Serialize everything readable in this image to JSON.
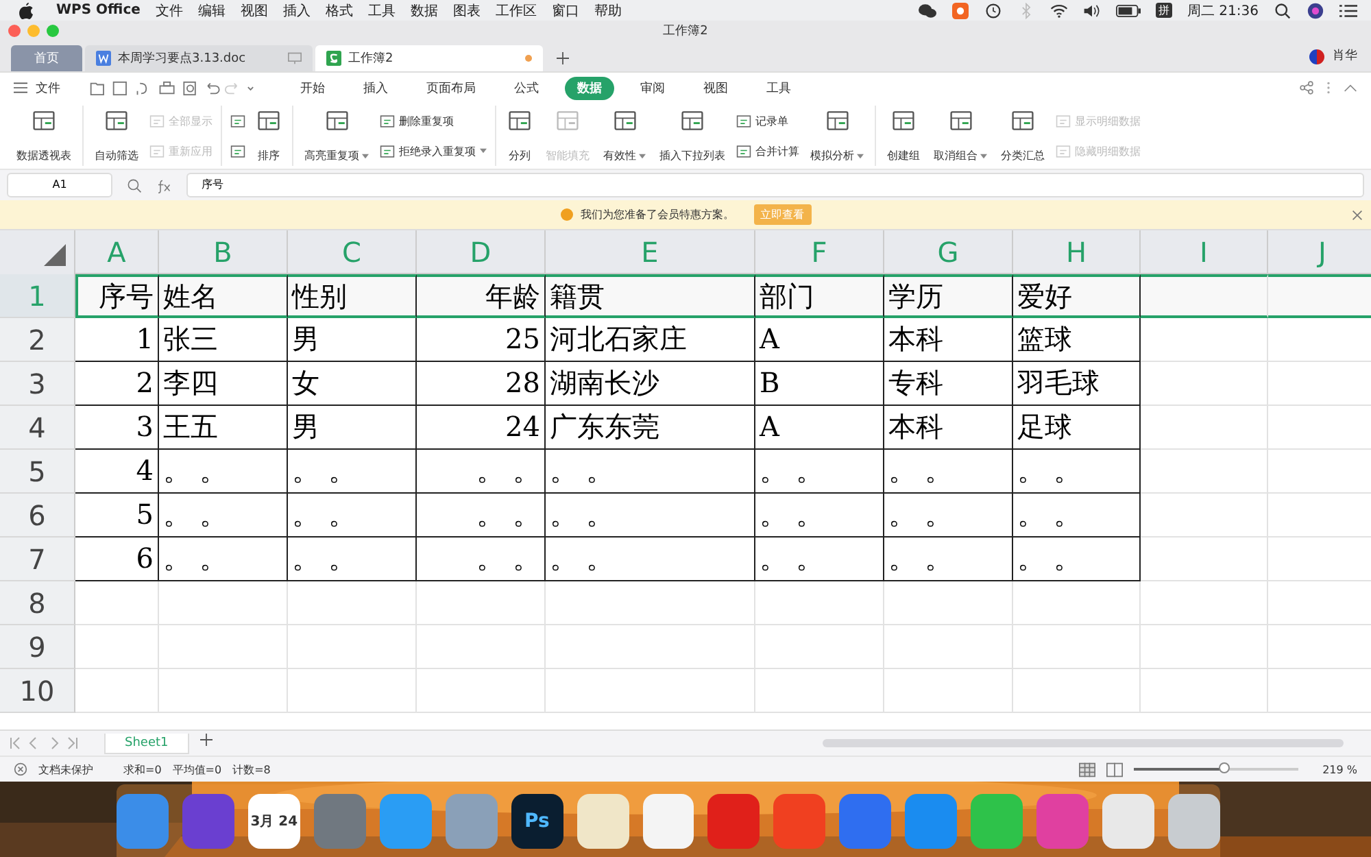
{
  "menubar": {
    "app": "WPS Office",
    "items": [
      "文件",
      "编辑",
      "视图",
      "插入",
      "格式",
      "工具",
      "数据",
      "图表",
      "工作区",
      "窗口",
      "帮助"
    ],
    "ime": "拼",
    "clock": "周二 21:36"
  },
  "window": {
    "title": "工作簿2",
    "user": "肖华"
  },
  "doc_tabs": [
    {
      "label": "首页",
      "kind": "home",
      "selected": false,
      "modified": false
    },
    {
      "label": "本周学习要点3.13.doc",
      "kind": "writer",
      "selected": false,
      "modified": false
    },
    {
      "label": "工作簿2",
      "kind": "sheet",
      "selected": true,
      "modified": true
    }
  ],
  "file_menu": "文件",
  "ribbon_tabs": [
    {
      "label": "开始",
      "selected": false
    },
    {
      "label": "插入",
      "selected": false
    },
    {
      "label": "页面布局",
      "selected": false
    },
    {
      "label": "公式",
      "selected": false
    },
    {
      "label": "数据",
      "selected": true
    },
    {
      "label": "审阅",
      "selected": false
    },
    {
      "label": "视图",
      "selected": false
    },
    {
      "label": "工具",
      "selected": false
    }
  ],
  "ribbon_groups": [
    [
      {
        "kind": "large",
        "label": "数据透视表",
        "disabled": false,
        "dropdown": false
      }
    ],
    [
      {
        "kind": "large",
        "label": "自动筛选",
        "disabled": false,
        "dropdown": false
      },
      {
        "kind": "stack",
        "items": [
          {
            "label": "全部显示",
            "disabled": true,
            "dropdown": false
          },
          {
            "label": "重新应用",
            "disabled": true,
            "dropdown": false
          }
        ]
      }
    ],
    [
      {
        "kind": "stack",
        "items": [
          {
            "disabled": false,
            "dropdown": false
          },
          {
            "disabled": false,
            "dropdown": false
          }
        ]
      },
      {
        "kind": "large",
        "label": "排序",
        "disabled": false,
        "dropdown": false
      }
    ],
    [
      {
        "kind": "large",
        "label": "高亮重复项",
        "disabled": false,
        "dropdown": true
      },
      {
        "kind": "stack",
        "items": [
          {
            "label": "删除重复项",
            "disabled": false,
            "dropdown": false
          },
          {
            "label": "拒绝录入重复项",
            "disabled": false,
            "dropdown": true
          }
        ]
      }
    ],
    [
      {
        "kind": "large",
        "label": "分列",
        "disabled": false,
        "dropdown": false
      },
      {
        "kind": "large",
        "label": "智能填充",
        "disabled": true,
        "dropdown": false
      },
      {
        "kind": "large",
        "label": "有效性",
        "disabled": false,
        "dropdown": true
      },
      {
        "kind": "large",
        "label": "插入下拉列表",
        "disabled": false,
        "dropdown": false
      },
      {
        "kind": "stack",
        "items": [
          {
            "label": "记录单",
            "disabled": false,
            "dropdown": false
          },
          {
            "label": "合并计算",
            "disabled": false,
            "dropdown": false
          }
        ]
      },
      {
        "kind": "large",
        "label": "模拟分析",
        "disabled": false,
        "dropdown": true
      }
    ],
    [
      {
        "kind": "large",
        "label": "创建组",
        "disabled": false,
        "dropdown": false
      },
      {
        "kind": "large",
        "label": "取消组合",
        "disabled": false,
        "dropdown": true
      },
      {
        "kind": "large",
        "label": "分类汇总",
        "disabled": false,
        "dropdown": false
      },
      {
        "kind": "stack",
        "items": [
          {
            "label": "显示明细数据",
            "disabled": true,
            "dropdown": false
          },
          {
            "label": "隐藏明细数据",
            "disabled": true,
            "dropdown": false
          }
        ]
      }
    ]
  ],
  "name_box": "A1",
  "formula": "序号",
  "notice": {
    "text": "我们为您准备了会员特惠方案。",
    "button": "立即查看"
  },
  "sheet": {
    "columns": [
      {
        "label": "A",
        "kind": "number"
      },
      {
        "label": "B",
        "kind": "text"
      },
      {
        "label": "C",
        "kind": "text"
      },
      {
        "label": "D",
        "kind": "number"
      },
      {
        "label": "E",
        "kind": "text"
      },
      {
        "label": "F",
        "kind": "text"
      },
      {
        "label": "G",
        "kind": "text"
      },
      {
        "label": "H",
        "kind": "text"
      },
      {
        "label": "I",
        "kind": "text"
      },
      {
        "label": "J",
        "kind": "text"
      }
    ],
    "rows": [
      {
        "number": "1",
        "selected": true,
        "cells": [
          "序号",
          "姓名",
          "性别",
          "年龄",
          "籍贯",
          "部门",
          "学历",
          "爱好"
        ]
      },
      {
        "number": "2",
        "selected": false,
        "cells": [
          "1",
          "张三",
          "男",
          "25",
          "河北石家庄",
          "A",
          "本科",
          "篮球"
        ]
      },
      {
        "number": "3",
        "selected": false,
        "cells": [
          "2",
          "李四",
          "女",
          "28",
          "湖南长沙",
          "B",
          "专科",
          "羽毛球"
        ]
      },
      {
        "number": "4",
        "selected": false,
        "cells": [
          "3",
          "王五",
          "男",
          "24",
          "广东东莞",
          "A",
          "本科",
          "足球"
        ]
      },
      {
        "number": "5",
        "selected": false,
        "cells": [
          "4",
          "。 。",
          "。 。",
          "。 。",
          "。 。",
          "。 。",
          "。 。",
          "。 。"
        ]
      },
      {
        "number": "6",
        "selected": false,
        "cells": [
          "5",
          "。 。",
          "。 。",
          "。 。",
          "。 。",
          "。 。",
          "。 。",
          "。 。"
        ]
      },
      {
        "number": "7",
        "selected": false,
        "cells": [
          "6",
          "。 。",
          "。 。",
          "。 。",
          "。 。",
          "。 。",
          "。 。",
          "。 。"
        ]
      },
      {
        "number": "8",
        "selected": false,
        "cells": []
      },
      {
        "number": "9",
        "selected": false,
        "cells": []
      },
      {
        "number": "10",
        "selected": false,
        "cells": []
      }
    ]
  },
  "sheet_tabs": [
    {
      "label": "Sheet1",
      "selected": true
    }
  ],
  "status_bar": {
    "protection": "文档未保护",
    "sum": "求和=0",
    "average": "平均值=0",
    "count": "计数=8",
    "zoom_slider": {
      "level": 0.55
    },
    "zoom": "219 %"
  },
  "dock": [
    {
      "color": "#3b8de8"
    },
    {
      "color": "#6a3fd0"
    },
    {
      "color": "#ffffff",
      "text": "3月 24"
    },
    {
      "color": "#707880"
    },
    {
      "color": "#2a9df4"
    },
    {
      "color": "#8aa0b8"
    },
    {
      "color": "#0a1e30",
      "text": "Ps"
    },
    {
      "color": "#f0e6c8"
    },
    {
      "color": "#f4f4f4"
    },
    {
      "color": "#e0201a"
    },
    {
      "color": "#f04020"
    },
    {
      "color": "#2f6ef0"
    },
    {
      "color": "#1a8cf0"
    },
    {
      "color": "#2ec24a"
    },
    {
      "color": "#e040a0"
    },
    {
      "color": "#e8e8e8"
    },
    {
      "color": "#c8ccd0"
    }
  ]
}
